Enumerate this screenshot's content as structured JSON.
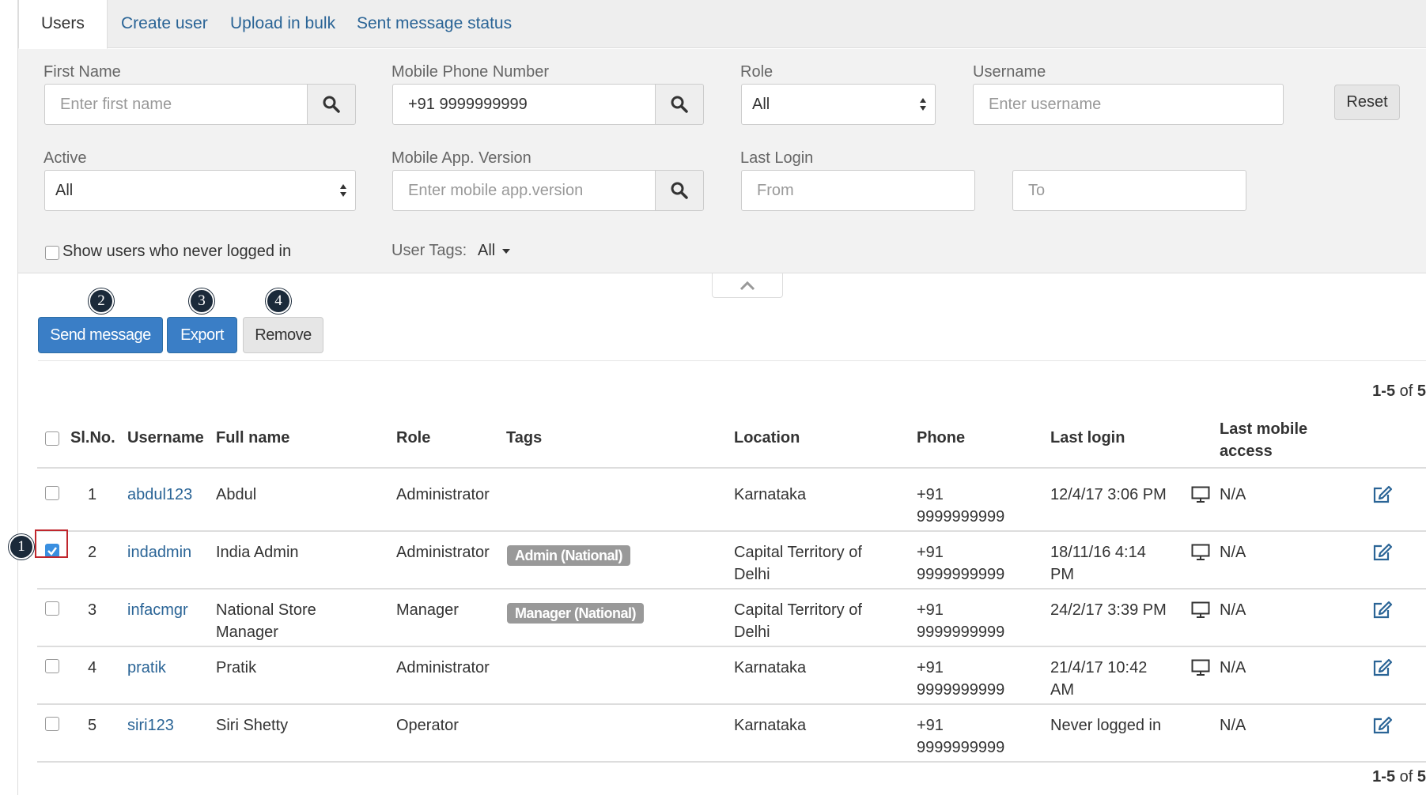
{
  "tabs": [
    {
      "label": "Users",
      "active": true
    },
    {
      "label": "Create user",
      "active": false
    },
    {
      "label": "Upload in bulk",
      "active": false
    },
    {
      "label": "Sent message status",
      "active": false
    }
  ],
  "filters": {
    "first_name": {
      "label": "First Name",
      "placeholder": "Enter first name",
      "value": ""
    },
    "mobile_phone": {
      "label": "Mobile Phone Number",
      "placeholder": "",
      "value": "+91 9999999999"
    },
    "role": {
      "label": "Role",
      "value": "All"
    },
    "username": {
      "label": "Username",
      "placeholder": "Enter username",
      "value": ""
    },
    "reset_label": "Reset",
    "active": {
      "label": "Active",
      "value": "All"
    },
    "app_version": {
      "label": "Mobile App. Version",
      "placeholder": "Enter mobile app.version",
      "value": ""
    },
    "last_login": {
      "label": "Last Login",
      "from_placeholder": "From",
      "to_placeholder": "To"
    },
    "never_logged_in_label": "Show users who never logged in",
    "user_tags": {
      "label": "User Tags:",
      "value": "All"
    }
  },
  "actions": {
    "send_message": "Send message",
    "export": "Export",
    "remove": "Remove"
  },
  "callouts": [
    "1",
    "2",
    "3",
    "4"
  ],
  "pagination": {
    "range": "1-5",
    "of_text": "of",
    "total": "5"
  },
  "table": {
    "headers": {
      "slno": "Sl.No.",
      "username": "Username",
      "full_name": "Full name",
      "role": "Role",
      "tags": "Tags",
      "location": "Location",
      "phone": "Phone",
      "last_login": "Last login",
      "last_mobile_1": "Last mobile",
      "last_mobile_2": "access"
    },
    "rows": [
      {
        "slno": "1",
        "username": "abdul123",
        "full_name_1": "Abdul",
        "full_name_2": "",
        "role": "Administrator",
        "tag": "",
        "location_1": "Karnataka",
        "location_2": "",
        "phone_1": "+91",
        "phone_2": "9999999999",
        "last_login_1": "12/4/17 3:06 PM",
        "last_login_2": "",
        "last_mobile": "N/A",
        "checked": false,
        "monitor": true
      },
      {
        "slno": "2",
        "username": "indadmin",
        "full_name_1": "India Admin",
        "full_name_2": "",
        "role": "Administrator",
        "tag": "Admin (National)",
        "location_1": "Capital Territory of",
        "location_2": "Delhi",
        "phone_1": "+91",
        "phone_2": "9999999999",
        "last_login_1": "18/11/16 4:14",
        "last_login_2": "PM",
        "last_mobile": "N/A",
        "checked": true,
        "monitor": true
      },
      {
        "slno": "3",
        "username": "infacmgr",
        "full_name_1": "National Store",
        "full_name_2": "Manager",
        "role": "Manager",
        "tag": "Manager (National)",
        "location_1": "Capital Territory of",
        "location_2": "Delhi",
        "phone_1": "+91",
        "phone_2": "9999999999",
        "last_login_1": "24/2/17 3:39 PM",
        "last_login_2": "",
        "last_mobile": "N/A",
        "checked": false,
        "monitor": true
      },
      {
        "slno": "4",
        "username": "pratik",
        "full_name_1": "Pratik",
        "full_name_2": "",
        "role": "Administrator",
        "tag": "",
        "location_1": "Karnataka",
        "location_2": "",
        "phone_1": "+91",
        "phone_2": "9999999999",
        "last_login_1": "21/4/17 10:42",
        "last_login_2": "AM",
        "last_mobile": "N/A",
        "checked": false,
        "monitor": true
      },
      {
        "slno": "5",
        "username": "siri123",
        "full_name_1": "Siri Shetty",
        "full_name_2": "",
        "role": "Operator",
        "tag": "",
        "location_1": "Karnataka",
        "location_2": "",
        "phone_1": "+91",
        "phone_2": "9999999999",
        "last_login_1": "Never logged in",
        "last_login_2": "",
        "last_mobile": "N/A",
        "checked": false,
        "monitor": false
      }
    ]
  },
  "colors": {
    "primary": "#3a7ec6",
    "link": "#2a6496",
    "tag": "#999999",
    "highlight": "#c0262d",
    "callout": "#1b2a3a"
  }
}
